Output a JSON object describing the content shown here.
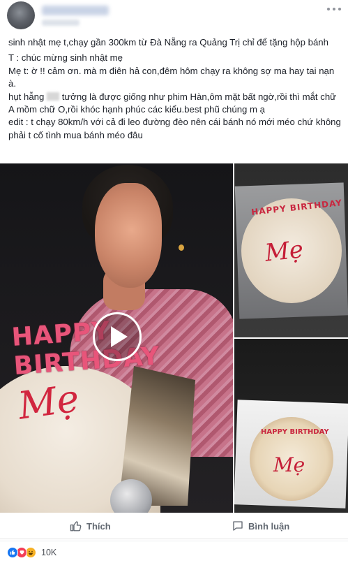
{
  "caption": {
    "line1": "sinh nhật mẹ t,chạy gần 300km từ Đà Nẵng ra Quảng Trị chỉ để tặng hộp bánh",
    "line2": "T : chúc mừng sinh nhật mẹ",
    "line3": "Mẹ t: ờ !! cảm ơn. mà m điên hả con,đêm hôm chạy ra không sợ ma hay tai nạn à.",
    "line4a": "hụt hẫng",
    "line4b": "tưởng là được giống như phim Hàn,ôm mặt bất ngờ,rồi thì mắt chữ A mồm chữ O,rồi khóc hạnh phúc các kiểu.best phũ chúng m ạ",
    "line5": "edit : t chạy 80km/h với cả đi leo đường đèo nên cái bánh nó mới méo chứ không phải t cố tình mua bánh méo đâu"
  },
  "media": {
    "main_candle_text": "HAPPY BIRTHDAY",
    "main_cake_text": "Mẹ",
    "top_cake_text": "HAPPY BIRTHDAY",
    "top_cake_name": "Mẹ",
    "bottom_cake_text": "HAPPY BIRTHDAY",
    "bottom_cake_name": "Mẹ"
  },
  "actions": {
    "like_label": "Thích",
    "comment_label": "Bình luận"
  },
  "reactions": {
    "types": [
      "like",
      "love",
      "haha"
    ],
    "count": "10K"
  },
  "colors": {
    "reaction_like": "#1877f2",
    "reaction_love": "#f33e58",
    "reaction_haha": "#f7b125"
  }
}
